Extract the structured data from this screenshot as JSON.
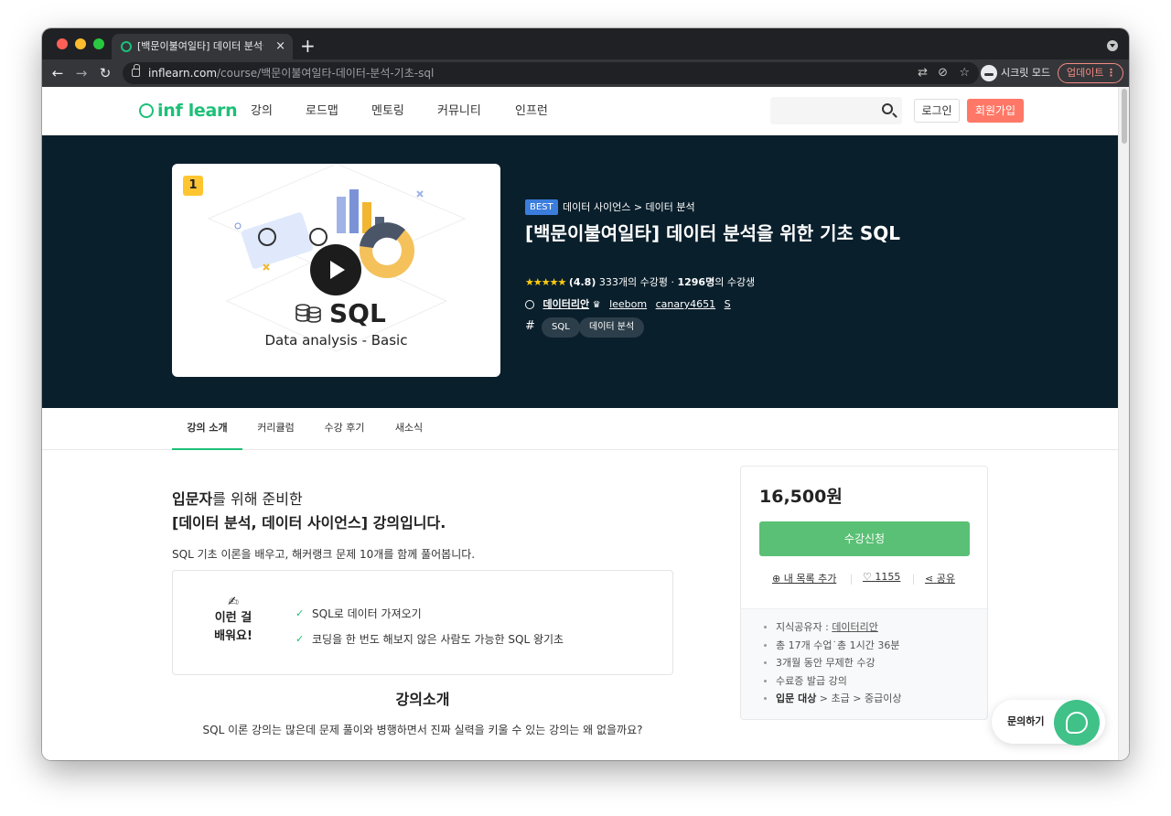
{
  "browser": {
    "tab_title": "[백문이불여일타] 데이터 분석을 위한 기초 SQL",
    "tab_close": "×",
    "new_tab": "+",
    "url_host": "inflearn.com",
    "url_path": "/course/백문이불여일타-데이터-분석-기초-sql",
    "incognito_label": "시크릿 모드",
    "update_label": "업데이트",
    "update_dots": "⋮",
    "nav_back": "←",
    "nav_forward": "→",
    "nav_reload": "↻"
  },
  "site": {
    "logo": "inf learn",
    "menu": [
      "강의",
      "로드맵",
      "멘토링",
      "커뮤니티",
      "인프런"
    ],
    "login": "로그인",
    "signup": "회원가입"
  },
  "course": {
    "rank": "1",
    "thumb_title": "SQL",
    "thumb_subtitle": "Data analysis - Basic",
    "badge": "BEST",
    "category": "데이터 사이언스 > 데이터 분석",
    "title": "[백문이불여일타] 데이터 분석을 위한 기초 SQL",
    "stars": "★★★★★",
    "rating": "(4.8)",
    "review_count": "333개의 수강평",
    "separator": "·",
    "students_bold": "1296명",
    "students_suffix": "의 수강생",
    "instructor_main": "데이터리안",
    "instructor_crown": "♛",
    "instructors": [
      "leebom",
      "canary4651",
      "S"
    ],
    "hash": "#",
    "tags": [
      "SQL",
      "데이터 분석"
    ]
  },
  "tabs": [
    "강의 소개",
    "커리큘럼",
    "수강 후기",
    "새소식"
  ],
  "intro": {
    "title_bold1": "입문자",
    "title_rest1": "를 위해 준비한",
    "title_line2": "[데이터 분석, 데이터 사이언스] 강의입니다.",
    "desc": "SQL 기초 이론을 배우고, 해커랭크 문제 10개를 함께 풀어봅니다.",
    "learn_icon": "✍",
    "learn_head_1": "이런 걸",
    "learn_head_2": "배워요!",
    "learn_items": [
      "SQL로 데이터 가져오기",
      "코딩을 한 번도 해보지 않은 사람도 가능한 SQL 왕기초"
    ],
    "check": "✓",
    "section_title": "강의소개",
    "section_desc": "SQL 이론 강의는 많은데 문제 풀이와 병행하면서 진짜 실력을 키울 수 있는 강의는 왜 없을까요?"
  },
  "card": {
    "price": "16,500원",
    "enroll": "수강신청",
    "wishlist": "내 목록 추가",
    "wishlist_icon": "⊕",
    "likes": "1155",
    "like_icon": "♡",
    "share": "공유",
    "share_icon": "⋖",
    "info_sharer_label": "지식공유자 : ",
    "info_sharer": "데이터리안",
    "info_lessons": "총 17개 수업˙총 1시간 36분",
    "info_period": "3개월 동안 무제한 수강",
    "info_cert": "수료증 발급 강의",
    "info_level_label": "입문 대상",
    "info_level_rest": " > 초급 > 중급이상"
  },
  "chat": {
    "label": "문의하기"
  },
  "colors": {
    "brand_green": "#1dc078",
    "hero_bg": "#0a1f2c",
    "signup": "#ff7867",
    "enroll": "#5ac075"
  }
}
